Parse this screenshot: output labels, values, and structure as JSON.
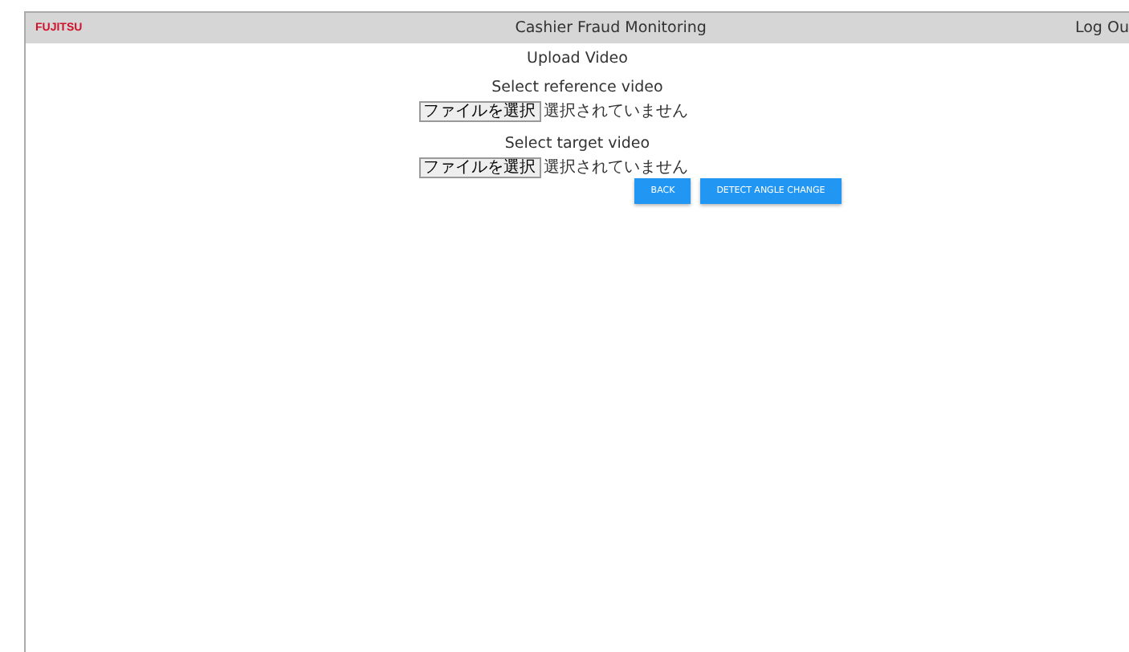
{
  "header": {
    "logo": "FUJITSU",
    "title": "Cashier Fraud Monitoring",
    "logout": "Log Ou"
  },
  "page_title": "Upload Video",
  "uploads": [
    {
      "label": "Select reference video",
      "button": "ファイルを選択",
      "status": "選択されていません"
    },
    {
      "label": "Select target video",
      "button": "ファイルを選択",
      "status": "選択されていません"
    }
  ],
  "buttons": [
    "BACK",
    "DETECT ANGLE CHANGE"
  ]
}
